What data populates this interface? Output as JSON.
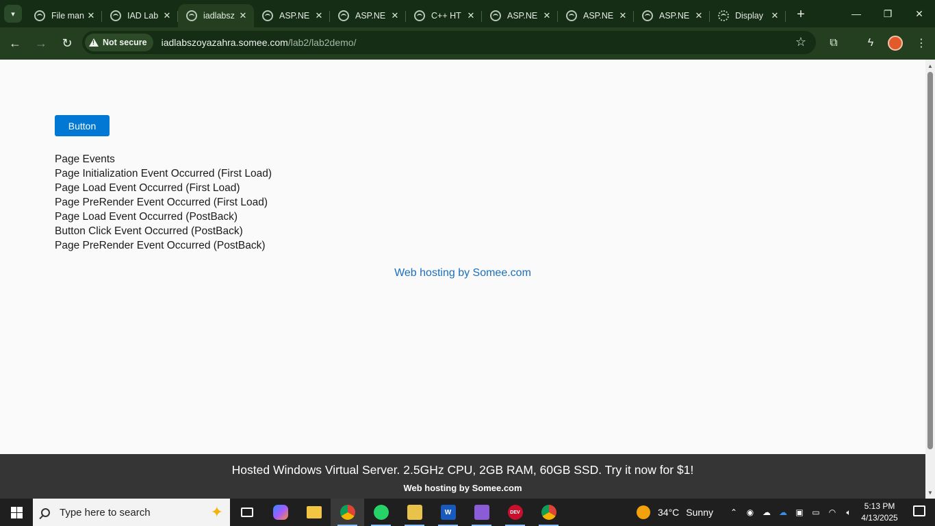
{
  "browser": {
    "tabs": [
      {
        "title": "File man",
        "active": false
      },
      {
        "title": "IAD Lab",
        "active": false
      },
      {
        "title": "iadlabsz",
        "active": true
      },
      {
        "title": "ASP.NE",
        "active": false
      },
      {
        "title": "ASP.NE",
        "active": false
      },
      {
        "title": "C++ HT",
        "active": false
      },
      {
        "title": "ASP.NE",
        "active": false
      },
      {
        "title": "ASP.NE",
        "active": false
      },
      {
        "title": "ASP.NE",
        "active": false
      },
      {
        "title": "Display",
        "active": false
      }
    ],
    "security_label": "Not secure",
    "url_host": "iadlabszoyazahra.somee.com",
    "url_path": "/lab2/lab2demo/"
  },
  "page": {
    "button_label": "Button",
    "events": [
      "Page Events",
      "Page Initialization Event Occurred (First Load)",
      "Page Load Event Occurred (First Load)",
      "Page PreRender Event Occurred (First Load)",
      "Page Load Event Occurred (PostBack)",
      "Button Click Event Occurred (PostBack)",
      "Page PreRender Event Occurred (PostBack)"
    ],
    "hosting_link": "Web hosting by Somee.com"
  },
  "banner": {
    "main": "Hosted Windows Virtual Server. 2.5GHz CPU, 2GB RAM, 60GB SSD. Try it now for $1!",
    "sub": "Web hosting by Somee.com"
  },
  "taskbar": {
    "search_placeholder": "Type here to search",
    "apps": [
      "task-view",
      "copilot",
      "file-explorer",
      "chrome",
      "whatsapp",
      "photo-editor",
      "word",
      "visual-studio",
      "dev-cpp",
      "chrome-profile"
    ],
    "weather": {
      "temp": "34°C",
      "condition": "Sunny"
    },
    "time": "5:13 PM",
    "date": "4/13/2025"
  },
  "colors": {
    "browser_frame": "#142d14",
    "toolbar": "#243f1f",
    "button_blue": "#0078d4",
    "link_blue": "#1a6ec0",
    "banner": "#353535",
    "taskbar": "#1f1f1f"
  }
}
